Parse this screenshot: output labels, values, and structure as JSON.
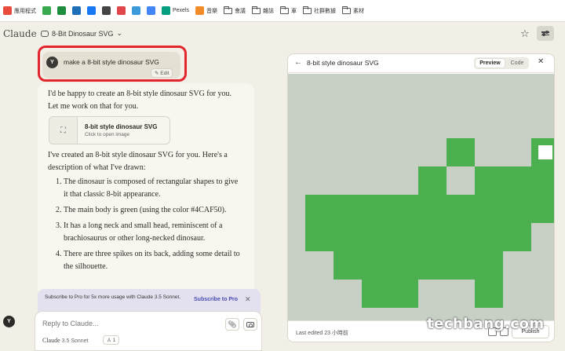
{
  "bookmarks": [
    {
      "label": "應用程式",
      "icon": "apps-grid-icon",
      "color": "#e84c3d"
    },
    {
      "label": "",
      "icon": "puzzle-icon",
      "color": "#39a94f"
    },
    {
      "label": "",
      "icon": "sheets-icon",
      "color": "#1e8e3e"
    },
    {
      "label": "",
      "icon": "c-logo-icon",
      "color": "#1d6fb8"
    },
    {
      "label": "",
      "icon": "meta-icon",
      "color": "#1877f2"
    },
    {
      "label": "",
      "icon": "notion-icon",
      "color": "#444444"
    },
    {
      "label": "",
      "icon": "chart-icon",
      "color": "#e0464a"
    },
    {
      "label": "",
      "icon": "s-logo-icon",
      "color": "#3b9ad9"
    },
    {
      "label": "",
      "icon": "g-logo-icon",
      "color": "#4285f4"
    },
    {
      "label": "Pexels",
      "icon": "pexels-icon",
      "color": "#05a081"
    },
    {
      "label": "音樂",
      "icon": "music-icon",
      "color": "#f28c28"
    },
    {
      "label": "會議",
      "icon": "folder-icon",
      "color": ""
    },
    {
      "label": "雜誌",
      "icon": "folder-icon",
      "color": ""
    },
    {
      "label": "車",
      "icon": "folder-icon",
      "color": ""
    },
    {
      "label": "社群數據",
      "icon": "folder-icon",
      "color": ""
    },
    {
      "label": "素材",
      "icon": "folder-icon",
      "color": ""
    }
  ],
  "header": {
    "logo": "Claude",
    "conversation_title": "8-Bit Dinosaur SVG",
    "caret": "⌄",
    "star_glyph": "☆"
  },
  "user_message": {
    "avatar": "Y",
    "text": "make a 8-bit style dinosaur SVG",
    "edit_label": "✎ Edit"
  },
  "assistant": {
    "intro": "I'd be happy to create an 8-bit style dinosaur SVG for you. Let me work on that for you.",
    "artifact": {
      "title": "8-bit style dinosaur SVG",
      "subtitle": "Click to open image"
    },
    "created": "I've created an 8-bit style dinosaur SVG for you. Here's a description of what I've drawn:",
    "list": [
      {
        "num": "1.",
        "text": "The dinosaur is composed of rectangular shapes to give it that classic 8-bit appearance."
      },
      {
        "num": "2.",
        "text": "The main body is green (using the color #4CAF50)."
      },
      {
        "num": "3.",
        "text": "It has a long neck and small head, reminiscent of a brachiosaurus or other long-necked dinosaur."
      },
      {
        "num": "4.",
        "text": "There are three spikes on its back, adding some detail to the silhouette."
      }
    ]
  },
  "subscribe": {
    "text": "Subscribe to Pro for 5x more usage with Claude 3.5 Sonnet.",
    "link": "Subscribe to Pro",
    "close": "✕"
  },
  "composer": {
    "placeholder": "Reply to Claude...",
    "model": "Claude",
    "model_version": "3.5 Sonnet",
    "badge": "1"
  },
  "side_avatar": "Y",
  "panel": {
    "title": "8-bit style dinosaur SVG",
    "tab_preview": "Preview",
    "tab_code": "Code",
    "close": "✕",
    "back": "←",
    "last_edited": "Last edited 23 小時前",
    "publish": "Publish",
    "colors": {
      "background": "#c8d0c6",
      "dino": "#4caf50",
      "eye": "#ffffff"
    }
  },
  "watermark": {
    "text": "techbang.com"
  }
}
